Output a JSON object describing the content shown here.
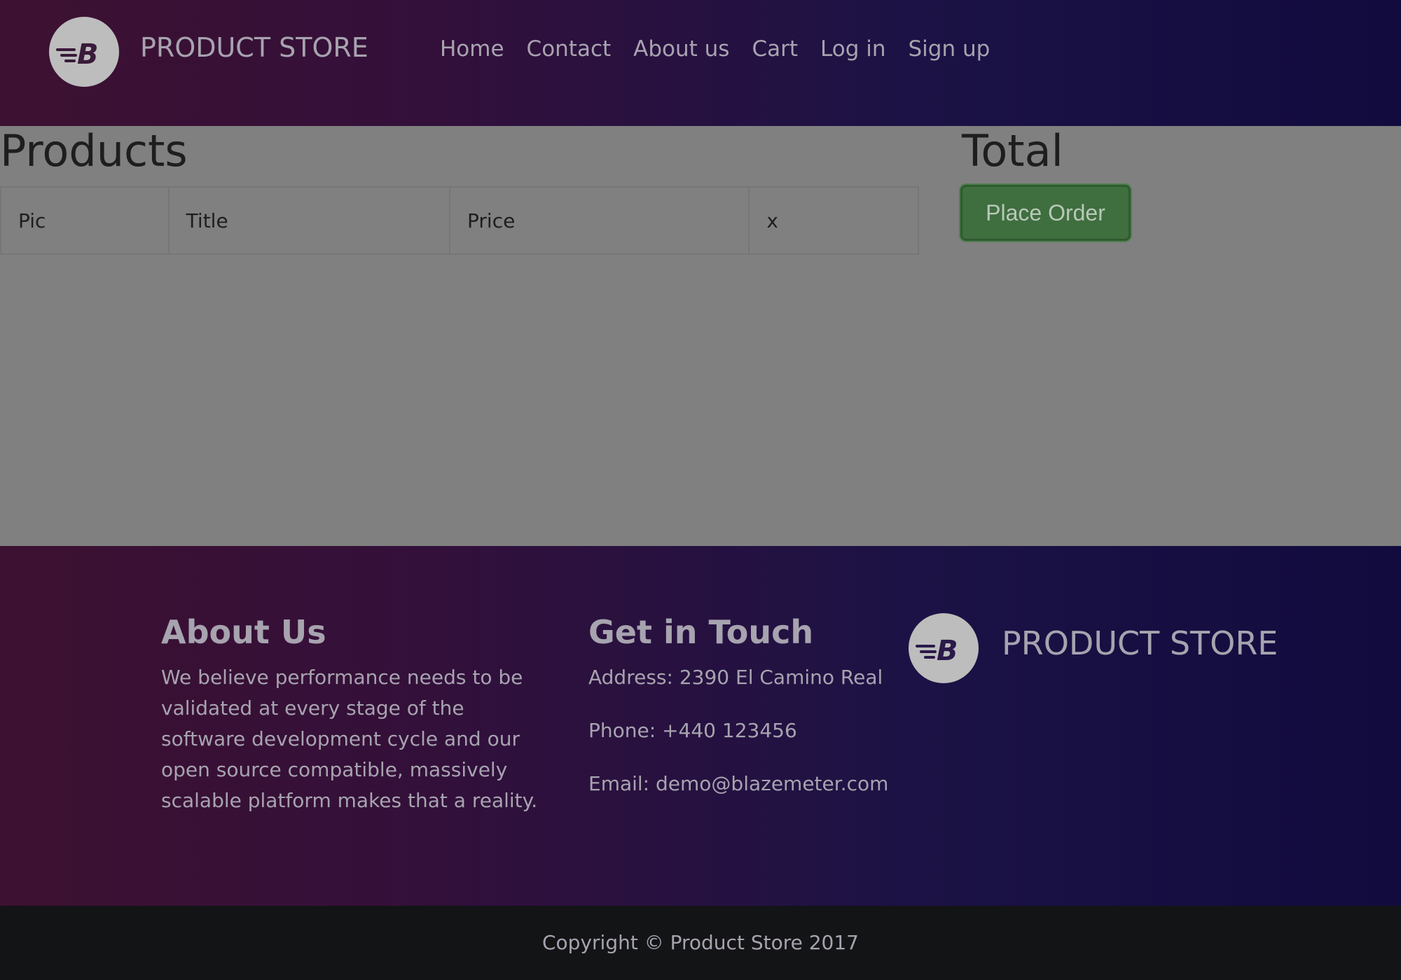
{
  "header": {
    "brand": "PRODUCT STORE",
    "logo_letter": "B",
    "nav": [
      "Home",
      "Contact",
      "About us",
      "Cart",
      "Log in",
      "Sign up"
    ]
  },
  "main": {
    "products_title": "Products",
    "table_headers": [
      "Pic",
      "Title",
      "Price",
      "x"
    ],
    "total_title": "Total",
    "place_order_label": "Place Order"
  },
  "footer": {
    "about_title": "About Us",
    "about_text": "We believe performance needs to be validated at every stage of the software development cycle and our open source compatible, massively scalable platform makes that a reality.",
    "contact_title": "Get in Touch",
    "address": "Address: 2390 El Camino Real",
    "phone": "Phone: +440 123456",
    "email": "Email: demo@blazemeter.com",
    "brand": "PRODUCT STORE",
    "copyright": "Copyright © Product Store 2017"
  },
  "colors": {
    "header_gradient_start": "#3d1131",
    "header_gradient_end": "#110b3e",
    "place_order_bg": "#3f6e3f",
    "overlay_gray": "#808080"
  }
}
